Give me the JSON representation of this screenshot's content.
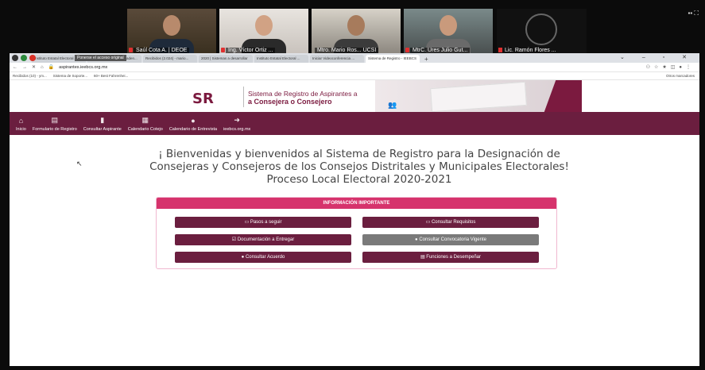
{
  "conference": {
    "participants": [
      {
        "name": "Saúl Cota A. | DEOE"
      },
      {
        "name": "Ing. Víctor Ortiz ..."
      },
      {
        "name": "Mtro. Mario Ros... UCSI"
      },
      {
        "name": "MtrC. Ures Julio Gut..."
      }
    ],
    "logo_participant": "Lic. Ramón Flores ..."
  },
  "browser": {
    "tooltip": "Ponerse el acceso original",
    "tabs": [
      "Instituto Estatal Electoral...",
      "Recibidos (57) - sistemaden...",
      "Recibidos (2.024) - mario...",
      "2020 | Sistemas a desarrollar",
      "Instituto Estatal Electoral ...",
      "Iniciar Videoconferencia ...",
      "Sistema de Registro - IEEBCS"
    ],
    "url": "aspirantes.ieebcs.org.mx",
    "bookmarks": [
      "Recibidos (10) - ym...",
      "Sistema de Soporte...",
      "60+ Best Fahrenhei..."
    ],
    "other_bookmarks": "Otros marcadores"
  },
  "site": {
    "logo_abbr": "SR",
    "logo_line1": "Sistema de Registro de Aspirantes a",
    "logo_line2": "a Consejera o Consejero",
    "nav": [
      {
        "label": "Inicio",
        "icon": "home-icon"
      },
      {
        "label": "Formulario de Registro",
        "icon": "id-card-icon"
      },
      {
        "label": "Consultar Aspirante",
        "icon": "file-icon"
      },
      {
        "label": "Calendario Cotejo",
        "icon": "calendar-icon"
      },
      {
        "label": "Calendario de Entrevista",
        "icon": "chat-icon"
      },
      {
        "label": "ieebcs.org.mx",
        "icon": "exit-icon"
      }
    ],
    "welcome": {
      "line1": "¡ Bienvenidas y bienvenidos al Sistema de Registro para la Designación de",
      "line2": "Consejeras y Consejeros de los Consejos Distritales y Municipales Electorales!",
      "line3": "Proceso Local Electoral 2020-2021"
    },
    "info": {
      "heading": "INFORMACIÓN IMPORTANTE",
      "buttons": [
        "▭ Pasos a seguir",
        "▭ Consultar Requisitos",
        "☑ Documentación a Entregar",
        "● Consultar Convocatoria Vigente",
        "● Consultar Acuerdo",
        "▤ Funciones a Desempeñar"
      ]
    }
  }
}
